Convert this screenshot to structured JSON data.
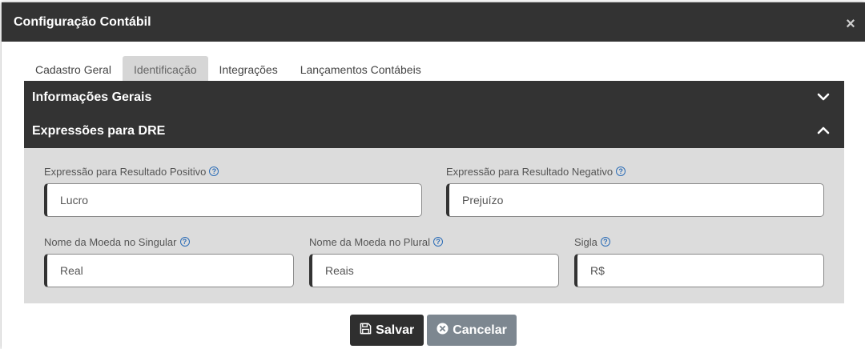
{
  "modal": {
    "title": "Configuração Contábil",
    "close_label": "×"
  },
  "tabs": [
    {
      "label": "Cadastro Geral",
      "active": false
    },
    {
      "label": "Identificação",
      "active": true
    },
    {
      "label": "Integrações",
      "active": false
    },
    {
      "label": "Lançamentos Contábeis",
      "active": false
    }
  ],
  "accordion": {
    "general": {
      "label": "Informações Gerais",
      "state": "collapsed",
      "icon": "chevron-down-icon"
    },
    "dre": {
      "label": "Expressões para DRE",
      "state": "expanded",
      "icon": "chevron-up-icon"
    }
  },
  "fields": {
    "positive": {
      "label": "Expressão para Resultado Positivo",
      "value": "Lucro"
    },
    "negative": {
      "label": "Expressão para Resultado Negativo",
      "value": "Prejuízo"
    },
    "singular": {
      "label": "Nome da Moeda no Singular",
      "value": "Real"
    },
    "plural": {
      "label": "Nome da Moeda no Plural",
      "value": "Reais"
    },
    "symbol": {
      "label": "Sigla",
      "value": "R$"
    }
  },
  "help_icon_glyph": "?",
  "buttons": {
    "save_label": "Salvar",
    "cancel_label": "Cancelar"
  },
  "colors": {
    "header_bg": "#333333",
    "active_tab_bg": "#d6d6d6",
    "panel_bg": "#dcdcdc",
    "save_bg": "#2f2f2f",
    "cancel_bg": "#7d8790",
    "help_icon": "#2c6db7"
  }
}
